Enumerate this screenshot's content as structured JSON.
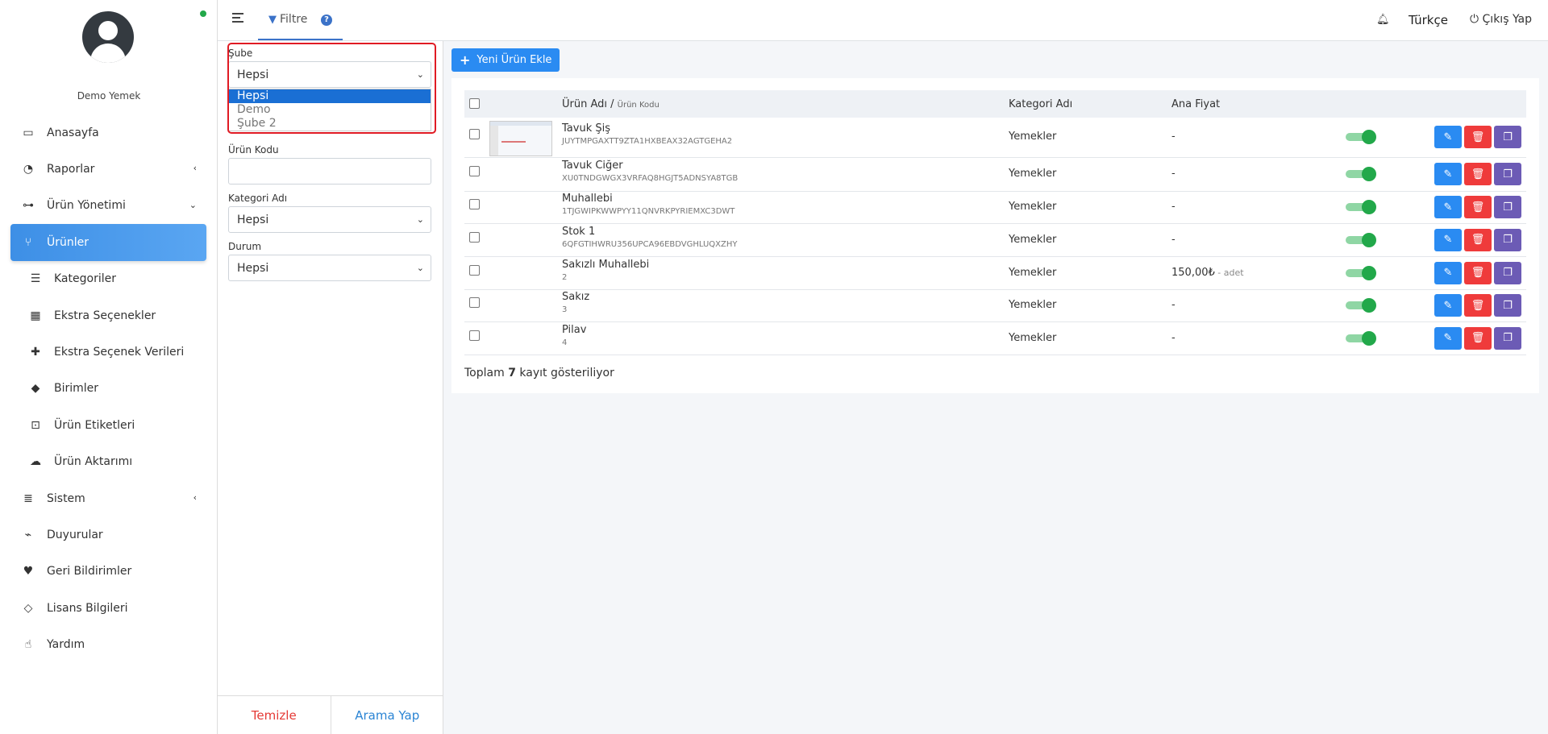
{
  "sidebar": {
    "user_name": "Demo Yemek",
    "items": [
      {
        "label": "Anasayfa",
        "icon": "monitor-icon",
        "glyph": "▭"
      },
      {
        "label": "Raporlar",
        "icon": "chart-icon",
        "glyph": "◔",
        "arrow": "‹"
      },
      {
        "label": "Ürün Yönetimi",
        "icon": "sitemap-icon",
        "glyph": "⊶",
        "arrow": "⌄"
      },
      {
        "label": "Ürünler",
        "icon": "utensils-icon",
        "glyph": "⑂",
        "active": true
      },
      {
        "label": "Kategoriler",
        "icon": "list-icon",
        "glyph": "☰",
        "sub": true
      },
      {
        "label": "Ekstra Seçenekler",
        "icon": "boxes-icon",
        "glyph": "▦",
        "sub": true
      },
      {
        "label": "Ekstra Seçenek Verileri",
        "icon": "puzzle-icon",
        "glyph": "✚",
        "sub": true
      },
      {
        "label": "Birimler",
        "icon": "tags-icon",
        "glyph": "◆",
        "sub": true
      },
      {
        "label": "Ürün Etiketleri",
        "icon": "tag-icon",
        "glyph": "⊡",
        "sub": true
      },
      {
        "label": "Ürün Aktarımı",
        "icon": "cloud-upload-icon",
        "glyph": "☁",
        "sub": true
      },
      {
        "label": "Sistem",
        "icon": "server-icon",
        "glyph": "≣",
        "arrow": "‹"
      },
      {
        "label": "Duyurular",
        "icon": "broadcast-icon",
        "glyph": "⌁"
      },
      {
        "label": "Geri Bildirimler",
        "icon": "heart-icon",
        "glyph": "♥"
      },
      {
        "label": "Lisans Bilgileri",
        "icon": "gem-icon",
        "glyph": "◇"
      },
      {
        "label": "Yardım",
        "icon": "hand-icon",
        "glyph": "☝"
      }
    ]
  },
  "topbar": {
    "filter_tab": "Filtre",
    "help": "?",
    "language": "Türkçe",
    "logout": "Çıkış Yap"
  },
  "filters": {
    "branch_label": "Şube",
    "branch_value": "Hepsi",
    "branch_options": [
      "Hepsi",
      "Demo",
      "Şube 2"
    ],
    "code_label": "Ürün Kodu",
    "code_value": "",
    "category_label": "Kategori Adı",
    "category_value": "Hepsi",
    "status_label": "Durum",
    "status_value": "Hepsi",
    "clear_button": "Temizle",
    "search_button": "Arama Yap"
  },
  "main": {
    "new_button": "Yeni Ürün Ekle",
    "columns": {
      "name": "Ürün Adı",
      "sep": " / ",
      "code": "Ürün Kodu",
      "category": "Kategori Adı",
      "price": "Ana Fiyat"
    },
    "rows": [
      {
        "name": "Tavuk Şiş",
        "code": "JUYTMPGAXTT9ZTA1HXBEAX32AGTGEHA2",
        "category": "Yemekler",
        "price": "-",
        "unit": "",
        "thumb": true
      },
      {
        "name": "Tavuk Ciğer",
        "code": "XU0TNDGWGX3VRFAQ8HGJT5ADNSYA8TGB",
        "category": "Yemekler",
        "price": "-",
        "unit": ""
      },
      {
        "name": "Muhallebi",
        "code": "1TJGWIPKWWPYY11QNVRKPYRIEMXC3DWT",
        "category": "Yemekler",
        "price": "-",
        "unit": ""
      },
      {
        "name": "Stok 1",
        "code": "6QFGTIHWRU356UPCA96EBDVGHLUQXZHY",
        "category": "Yemekler",
        "price": "-",
        "unit": ""
      },
      {
        "name": "Sakızlı Muhallebi",
        "code": "2",
        "category": "Yemekler",
        "price": "150,00₺",
        "unit": " - adet"
      },
      {
        "name": "Sakız",
        "code": "3",
        "category": "Yemekler",
        "price": "-",
        "unit": ""
      },
      {
        "name": "Pilav",
        "code": "4",
        "category": "Yemekler",
        "price": "-",
        "unit": ""
      }
    ],
    "total_prefix": "Toplam",
    "total_count": "7",
    "total_suffix": "kayıt gösteriliyor"
  },
  "colors": {
    "accent": "#2a8bf2",
    "delete": "#ef3b3b",
    "copy": "#6c5bb5",
    "toggle_on": "#22a84a",
    "highlight": "#e01b24"
  }
}
